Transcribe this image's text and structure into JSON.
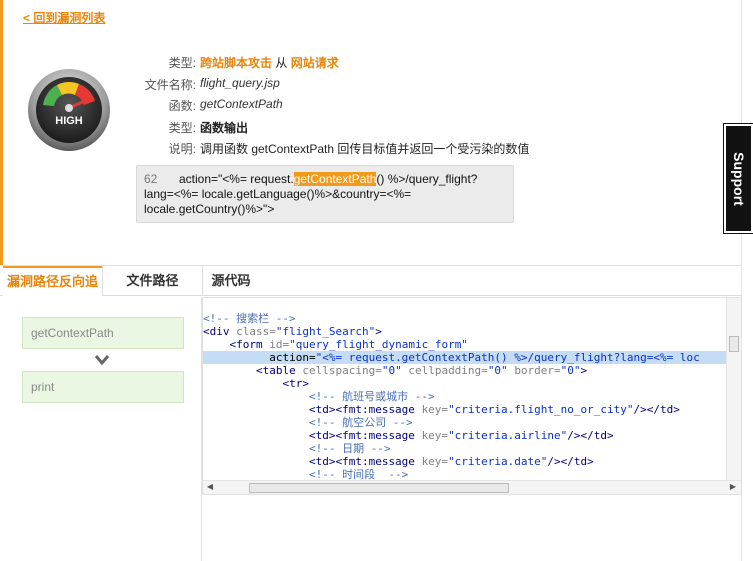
{
  "back_link": "< 回到漏洞列表",
  "severity": {
    "label": "HIGH",
    "colors": {
      "green": "#4caf50",
      "yellow": "#f3c623",
      "red": "#e53935"
    }
  },
  "info": {
    "type1": {
      "label": "类型:",
      "value_a": "跨站脚本攻击",
      "value_mid": " 从 ",
      "value_b": "网站请求"
    },
    "filename": {
      "label": "文件名称:",
      "value": "flight_query.jsp"
    },
    "function": {
      "label": "函数:",
      "value": "getContextPath"
    },
    "type2": {
      "label": "类型:",
      "value": "函数输出"
    },
    "desc": {
      "label": "说明:",
      "value": "调用函数 getContextPath 回传目标值并返回一个受污染的数值"
    }
  },
  "snippet": {
    "line_no": "62",
    "pre": "action=\"<%= request.",
    "highlight": "getContextPath",
    "post_line1": "() %>/query_flight?",
    "line2": "lang=<%= locale.getLanguage()%>&country=<%=",
    "line3": "locale.getCountry()%>\">"
  },
  "support_tab": "Support",
  "tabs": [
    {
      "label": "漏洞路径反向追"
    },
    {
      "label": "文件路径"
    },
    {
      "label": "源代码"
    }
  ],
  "trace": [
    {
      "label": "getContextPath"
    },
    {
      "label": "print"
    }
  ],
  "code": [
    {
      "indent": "",
      "parts": [
        [
          "cmt",
          "<!-- 搜索栏 -->"
        ]
      ]
    },
    {
      "indent": "",
      "parts": [
        [
          "tag",
          "<div "
        ],
        [
          "attr",
          "class="
        ],
        [
          "str",
          "\"flight_Search\""
        ],
        [
          "tag",
          ">"
        ]
      ]
    },
    {
      "indent": "    ",
      "parts": [
        [
          "tag",
          "<form "
        ],
        [
          "attr",
          "id="
        ],
        [
          "str",
          "\"query_flight_dynamic_form\""
        ]
      ]
    },
    {
      "indent": "          ",
      "sel": true,
      "parts": [
        [
          "txt",
          "action="
        ],
        [
          "str",
          "\"<%= request.getContextPath() %>/query_flight?lang=<%= loc"
        ]
      ]
    },
    {
      "indent": "        ",
      "parts": [
        [
          "tag",
          "<table "
        ],
        [
          "attr",
          "cellspacing="
        ],
        [
          "str",
          "\"0\" "
        ],
        [
          "attr",
          "cellpadding="
        ],
        [
          "str",
          "\"0\" "
        ],
        [
          "attr",
          "border="
        ],
        [
          "str",
          "\"0\""
        ],
        [
          "tag",
          ">"
        ]
      ]
    },
    {
      "indent": "            ",
      "parts": [
        [
          "tag",
          "<tr>"
        ]
      ]
    },
    {
      "indent": "                ",
      "parts": [
        [
          "cmt",
          "<!-- 航班号或城市 -->"
        ]
      ]
    },
    {
      "indent": "                ",
      "parts": [
        [
          "tag",
          "<td><fmt:message "
        ],
        [
          "attr",
          "key="
        ],
        [
          "str",
          "\"criteria.flight_no_or_city\""
        ],
        [
          "tag",
          "/></td>"
        ]
      ]
    },
    {
      "indent": "                ",
      "parts": [
        [
          "cmt",
          "<!-- 航空公司 -->"
        ]
      ]
    },
    {
      "indent": "                ",
      "parts": [
        [
          "tag",
          "<td><fmt:message "
        ],
        [
          "attr",
          "key="
        ],
        [
          "str",
          "\"criteria.airline\""
        ],
        [
          "tag",
          "/></td>"
        ]
      ]
    },
    {
      "indent": "                ",
      "parts": [
        [
          "cmt",
          "<!-- 日期 -->"
        ]
      ]
    },
    {
      "indent": "                ",
      "parts": [
        [
          "tag",
          "<td><fmt:message "
        ],
        [
          "attr",
          "key="
        ],
        [
          "str",
          "\"criteria.date\""
        ],
        [
          "tag",
          "/></td>"
        ]
      ]
    },
    {
      "indent": "                ",
      "parts": [
        [
          "cmt",
          "<!-- 时间段  -->"
        ]
      ]
    }
  ]
}
